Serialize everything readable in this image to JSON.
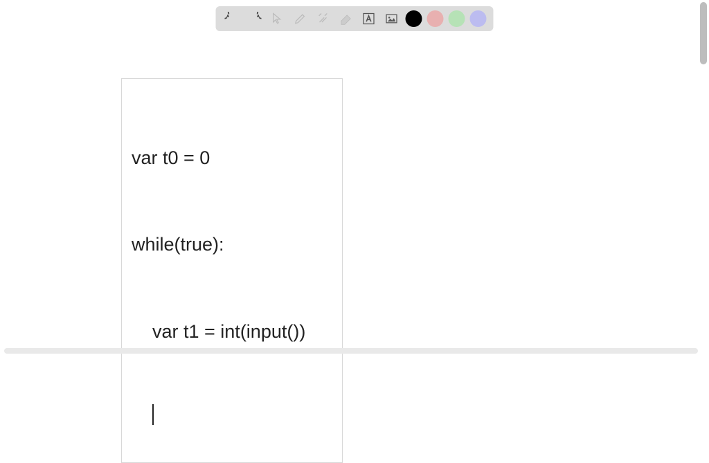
{
  "toolbar": {
    "tools": [
      {
        "name": "undo-icon"
      },
      {
        "name": "redo-icon"
      },
      {
        "name": "pointer-icon"
      },
      {
        "name": "pencil-icon"
      },
      {
        "name": "tools-icon"
      },
      {
        "name": "eraser-icon"
      },
      {
        "name": "text-icon"
      },
      {
        "name": "image-icon"
      }
    ],
    "colors": [
      {
        "name": "color-black",
        "hex": "#000000"
      },
      {
        "name": "color-pink",
        "hex": "#e8b0b0"
      },
      {
        "name": "color-green",
        "hex": "#b6e2b6"
      },
      {
        "name": "color-purple",
        "hex": "#bcbcf0"
      }
    ]
  },
  "textbox": {
    "line1": "var t0 = 0",
    "line2": "while(true):",
    "line3": "var t1 = int(input())"
  }
}
